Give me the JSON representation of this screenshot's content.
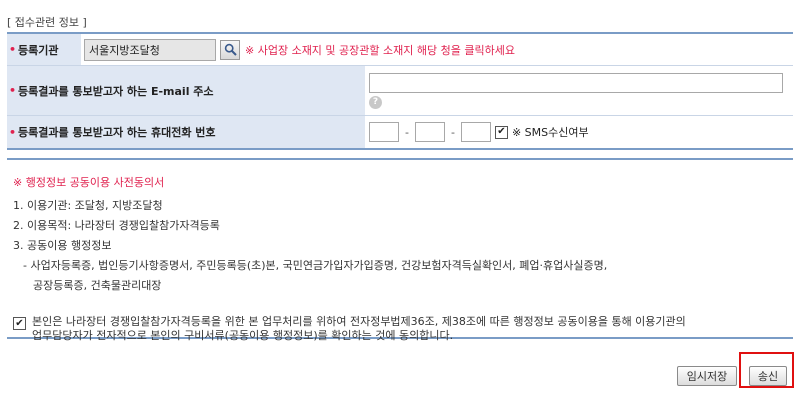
{
  "section": {
    "title": "[ 접수관련 정보 ]"
  },
  "form": {
    "agency": {
      "label": "등록기관",
      "value": "서울지방조달청",
      "notice": "※ 사업장 소재지 및 공장관할 소재지 해당 청을 클릭하세요"
    },
    "email": {
      "label": "등록결과를 통보받고자 하는 E-mail 주소",
      "value": ""
    },
    "phone": {
      "label": "등록결과를 통보받고자 하는 휴대전화 번호",
      "part1": "",
      "part2": "",
      "part3": "",
      "sms_label": "※ SMS수신여부",
      "sms_checked": true
    }
  },
  "consent": {
    "title": "※ 행정정보 공동이용 사전동의서",
    "lines": [
      "1. 이용기관: 조달청, 지방조달청",
      "2. 이용목적: 나라장터 경쟁입찰참가자격등록",
      "3. 공동이용 행정정보",
      "- 사업자등록증, 법인등기사항증명서, 주민등록등(초)본, 국민연금가입자가입증명, 건강보험자격득실확인서, 폐업·휴업사실증명,",
      "공장등록증, 건축물관리대장"
    ],
    "agree_text_1": "본인은 나라장터 경쟁입찰참가자격등록을 위한 본 업무처리를 위하여 전자정부법제36조, 제38조에 따른 행정정보 공동이용을 통해 이용기관의",
    "agree_text_2": "업무담당자가 전자적으로 본인의 구비서류(공동이용 행정정보)를 확인하는 것에 동의합니다.",
    "agree_checked": true
  },
  "buttons": {
    "temp_save": "임시저장",
    "send": "송신"
  },
  "colors": {
    "required_star": "#e0224f",
    "notice_red": "#e0224f",
    "label_bg": "#dfe7f3",
    "border_blue": "#7a9cc6",
    "highlight_red": "#e01010"
  }
}
